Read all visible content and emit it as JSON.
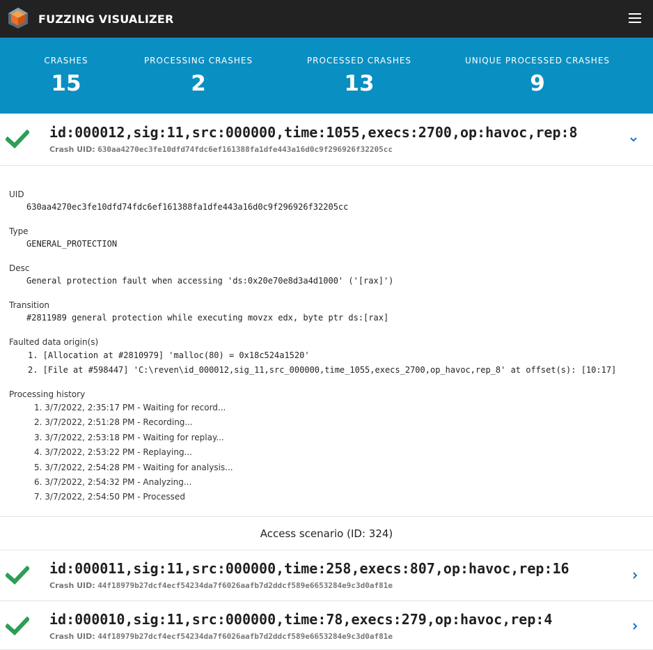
{
  "app": {
    "title": "FUZZING VISUALIZER",
    "logo_icon": "cube-logo-icon",
    "menu_icon": "hamburger-menu-icon"
  },
  "colors": {
    "header_bg": "#222222",
    "stats_bg": "#0a8fc2",
    "success": "#2e9e57",
    "link": "#1f6fd1"
  },
  "stats": [
    {
      "label": "CRASHES",
      "value": "15"
    },
    {
      "label": "PROCESSING CRASHES",
      "value": "2"
    },
    {
      "label": "PROCESSED CRASHES",
      "value": "13"
    },
    {
      "label": "UNIQUE PROCESSED CRASHES",
      "value": "9"
    }
  ],
  "expanded_crash": {
    "name": "id:000012,sig:11,src:000000,time:1055,execs:2700,op:havoc,rep:8",
    "uid_label": "Crash UID:",
    "uid": "630aa4270ec3fe10dfd74fdc6ef161388fa1dfe443a16d0c9f296926f32205cc",
    "status_icon": "check-icon",
    "toggle_icon": "chevron-down-icon"
  },
  "details": {
    "uid_label": "UID",
    "uid_value": "630aa4270ec3fe10dfd74fdc6ef161388fa1dfe443a16d0c9f296926f32205cc",
    "type_label": "Type",
    "type_value": "GENERAL_PROTECTION",
    "desc_label": "Desc",
    "desc_value": "General protection fault when accessing 'ds:0x20e70e8d3a4d1000' ('[rax]')",
    "transition_label": "Transition",
    "transition_value": "#2811989 general protection while executing movzx edx, byte ptr ds:[rax]",
    "origins_label": "Faulted data origin(s)",
    "origins": [
      "1. [Allocation at #2810979] 'malloc(80) = 0x18c524a1520'",
      "2. [File at #598447] 'C:\\reven\\id_000012,sig_11,src_000000,time_1055,execs_2700,op_havoc,rep_8' at offset(s): [10:17]"
    ],
    "history_label": "Processing history",
    "history": [
      "1. 3/7/2022, 2:35:17 PM - Waiting for record...",
      "2. 3/7/2022, 2:51:28 PM - Recording...",
      "3. 3/7/2022, 2:53:18 PM - Waiting for replay...",
      "4. 3/7/2022, 2:53:22 PM - Replaying...",
      "5. 3/7/2022, 2:54:28 PM - Waiting for analysis...",
      "6. 3/7/2022, 2:54:32 PM - Analyzing...",
      "7. 3/7/2022, 2:54:50 PM - Processed"
    ],
    "scenario": "Access scenario (ID: 324)"
  },
  "other_crashes": [
    {
      "name": "id:000011,sig:11,src:000000,time:258,execs:807,op:havoc,rep:16",
      "uid_label": "Crash UID:",
      "uid": "44f18979b27dcf4ecf54234da7f6026aafb7d2ddcf589e6653284e9c3d0af81e"
    },
    {
      "name": "id:000010,sig:11,src:000000,time:78,execs:279,op:havoc,rep:4",
      "uid_label": "Crash UID:",
      "uid": "44f18979b27dcf4ecf54234da7f6026aafb7d2ddcf589e6653284e9c3d0af81e"
    }
  ]
}
